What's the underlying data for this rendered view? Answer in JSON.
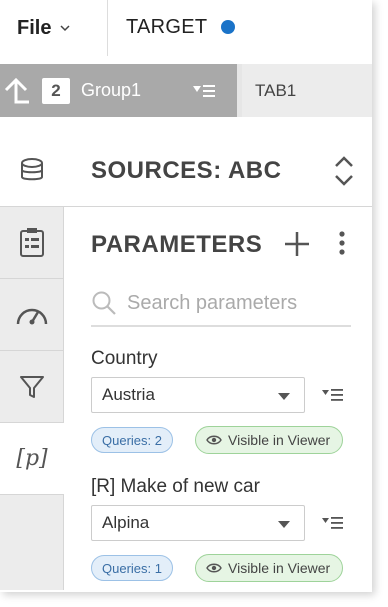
{
  "topbar": {
    "file_label": "File",
    "title": "TARGET",
    "status_dot_color": "#1a73c8"
  },
  "tabbar": {
    "group": {
      "count": "2",
      "name": "Group1"
    },
    "tabs": [
      {
        "label": "TAB1"
      }
    ]
  },
  "rail": {
    "items": [
      {
        "icon": "database-icon"
      },
      {
        "icon": "calculator-icon"
      },
      {
        "icon": "gauge-icon"
      },
      {
        "icon": "filter-icon"
      },
      {
        "icon": "parameters-icon",
        "glyph": "[p]",
        "active": true
      }
    ]
  },
  "sources": {
    "title": "SOURCES: ABC"
  },
  "parameters": {
    "title": "PARAMETERS",
    "search_placeholder": "Search parameters",
    "items": [
      {
        "label": "Country",
        "value": "Austria",
        "queries": "Queries: 2",
        "visibility": "Visible in Viewer"
      },
      {
        "label": "[R] Make of new car",
        "value": "Alpina",
        "queries": "Queries: 1",
        "visibility": "Visible in Viewer"
      }
    ]
  }
}
